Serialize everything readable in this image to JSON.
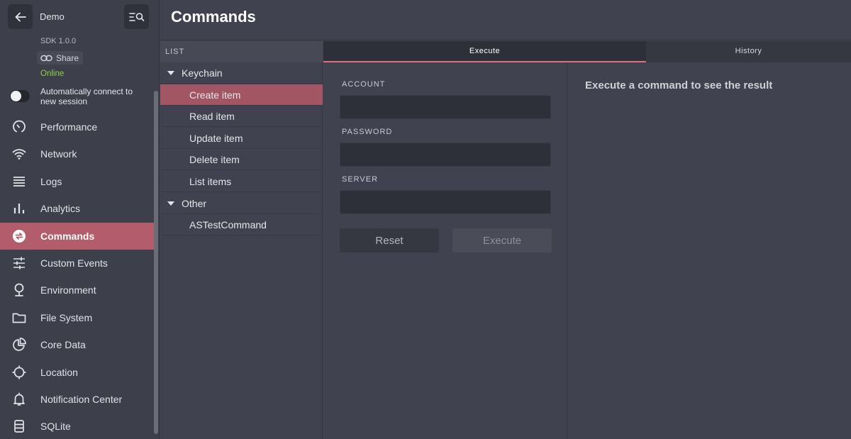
{
  "sidebar": {
    "app_name": "Demo",
    "sdk_version": "SDK 1.0.0",
    "share_label": "Share",
    "status": "Online",
    "auto_connect_label": "Automatically connect to new session",
    "auto_connect_enabled": false,
    "items": [
      {
        "label": "Performance",
        "icon": "gauge-icon"
      },
      {
        "label": "Network",
        "icon": "wifi-icon"
      },
      {
        "label": "Logs",
        "icon": "lines-icon"
      },
      {
        "label": "Analytics",
        "icon": "bar-chart-icon"
      },
      {
        "label": "Commands",
        "icon": "swap-arrows-icon",
        "active": true
      },
      {
        "label": "Custom Events",
        "icon": "sliders-icon"
      },
      {
        "label": "Environment",
        "icon": "pin-icon"
      },
      {
        "label": "File System",
        "icon": "folder-icon"
      },
      {
        "label": "Core Data",
        "icon": "pie-icon"
      },
      {
        "label": "Location",
        "icon": "crosshair-icon"
      },
      {
        "label": "Notification Center",
        "icon": "bell-icon"
      },
      {
        "label": "SQLite",
        "icon": "database-icon"
      }
    ]
  },
  "header": {
    "title": "Commands"
  },
  "list": {
    "header": "LIST",
    "groups": [
      {
        "label": "Keychain",
        "items": [
          "Create item",
          "Read item",
          "Update item",
          "Delete item",
          "List items"
        ]
      },
      {
        "label": "Other",
        "items": [
          "ASTestCommand"
        ]
      }
    ],
    "selected": "Create item"
  },
  "tabs": {
    "execute": "Execute",
    "history": "History"
  },
  "form": {
    "fields": [
      {
        "label": "ACCOUNT",
        "value": ""
      },
      {
        "label": "PASSWORD",
        "value": ""
      },
      {
        "label": "SERVER",
        "value": ""
      }
    ],
    "reset_label": "Reset",
    "execute_label": "Execute"
  },
  "result": {
    "placeholder": "Execute a command to see the result"
  },
  "colors": {
    "accent": "#b35c6b",
    "online": "#8fd14a",
    "tab_underline": "#e0707d"
  }
}
